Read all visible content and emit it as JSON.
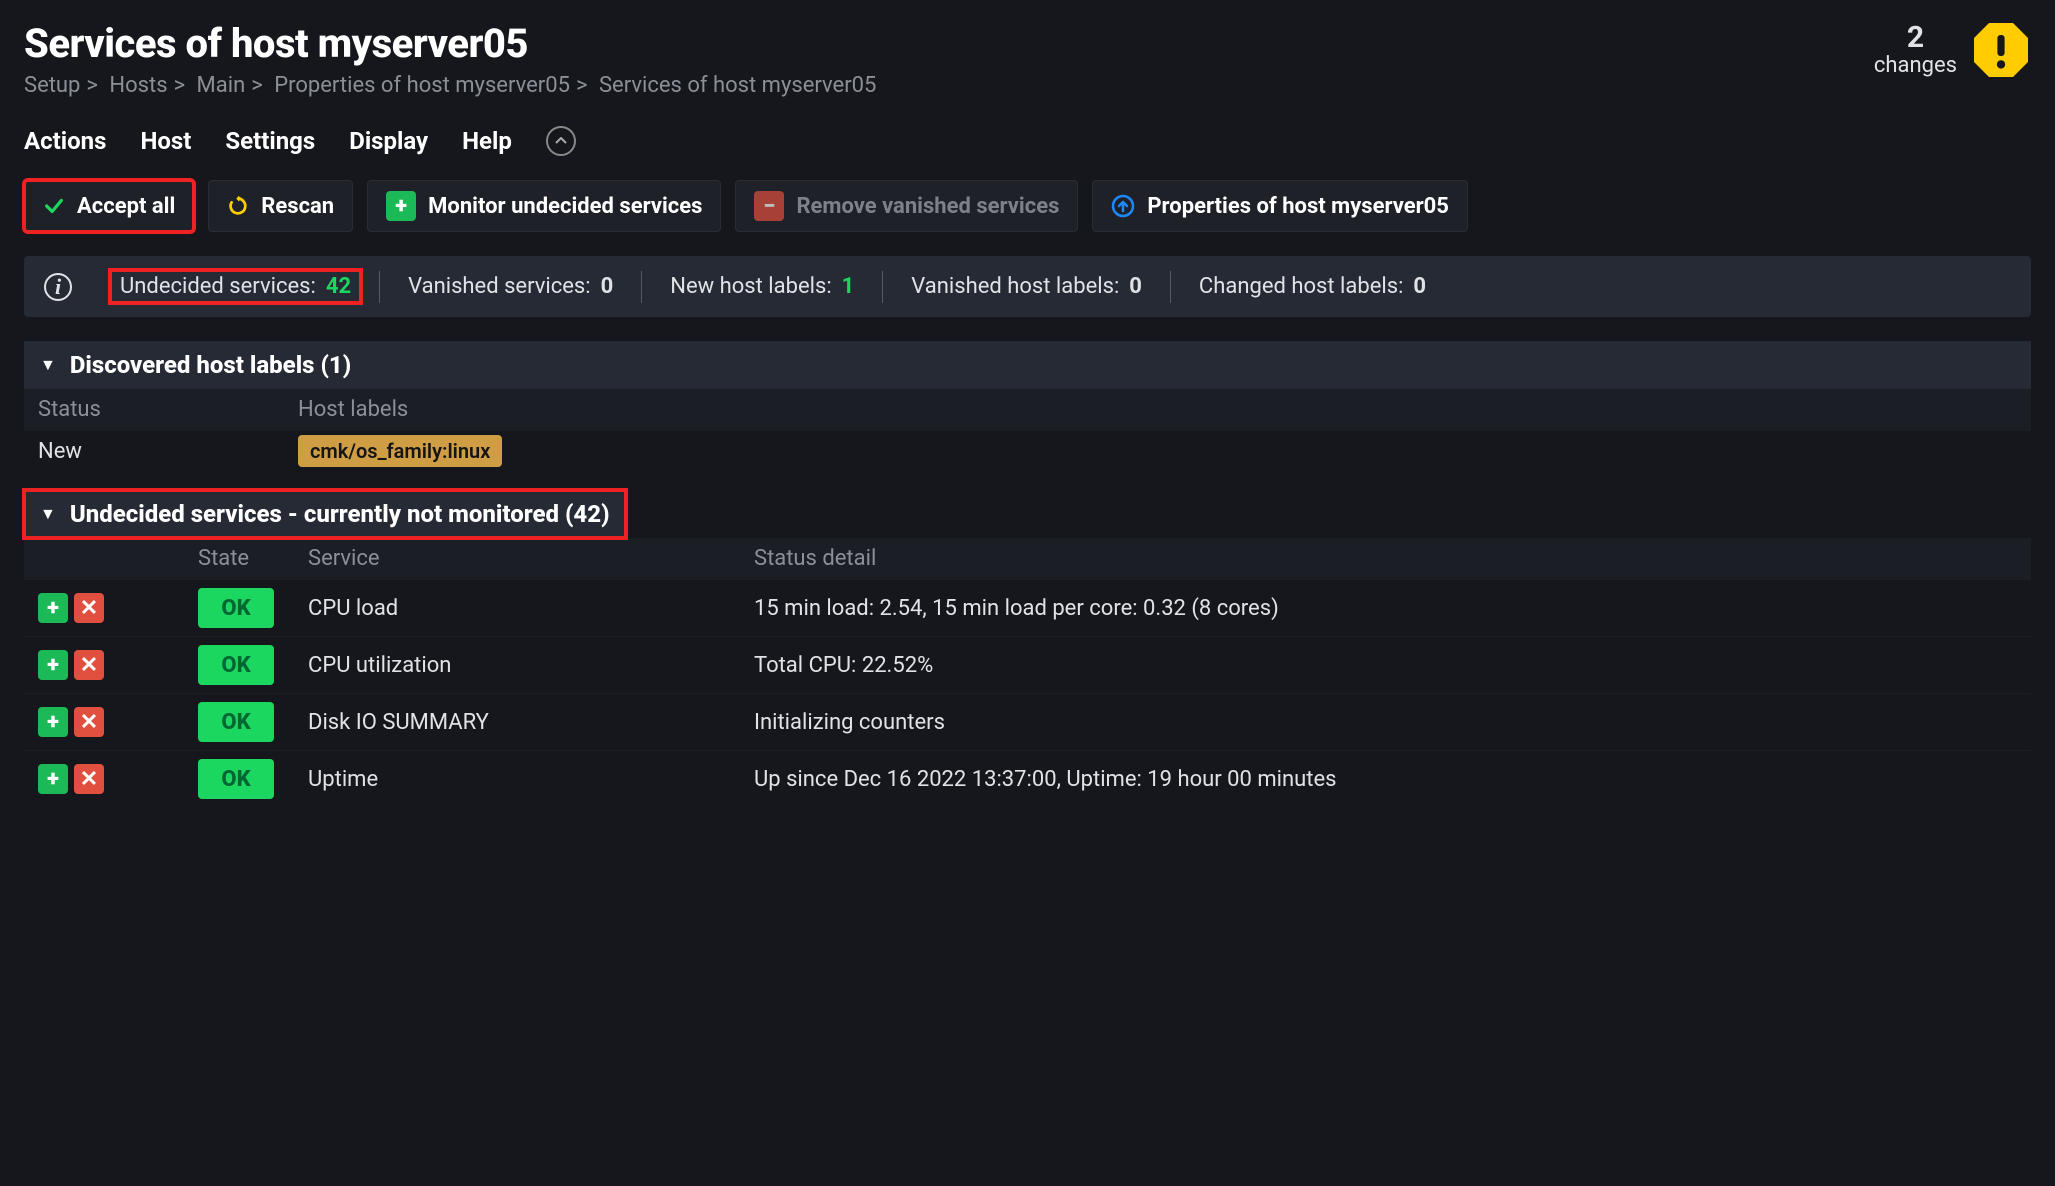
{
  "page_title": "Services of host myserver05",
  "breadcrumb": [
    "Setup",
    "Hosts",
    "Main",
    "Properties of host myserver05",
    "Services of host myserver05"
  ],
  "changes": {
    "count": "2",
    "label": "changes"
  },
  "menubar": [
    "Actions",
    "Host",
    "Settings",
    "Display",
    "Help"
  ],
  "toolbar": {
    "accept_all": "Accept all",
    "rescan": "Rescan",
    "monitor_undecided": "Monitor undecided services",
    "remove_vanished": "Remove vanished services",
    "properties": "Properties of host myserver05"
  },
  "stats": {
    "undecided_services": {
      "label": "Undecided services:",
      "value": "42"
    },
    "vanished_services": {
      "label": "Vanished services:",
      "value": "0"
    },
    "new_host_labels": {
      "label": "New host labels:",
      "value": "1"
    },
    "vanished_host_labels": {
      "label": "Vanished host labels:",
      "value": "0"
    },
    "changed_host_labels": {
      "label": "Changed host labels:",
      "value": "0"
    }
  },
  "discovered_labels": {
    "header": "Discovered host labels (1)",
    "columns": {
      "status": "Status",
      "labels": "Host labels"
    },
    "rows": [
      {
        "status": "New",
        "label": "cmk/os_family:linux"
      }
    ]
  },
  "undecided_services": {
    "header": "Undecided services - currently not monitored (42)",
    "columns": {
      "state": "State",
      "service": "Service",
      "detail": "Status detail"
    },
    "rows": [
      {
        "state": "OK",
        "service": "CPU load",
        "detail": "15 min load: 2.54, 15 min load per core: 0.32 (8 cores)"
      },
      {
        "state": "OK",
        "service": "CPU utilization",
        "detail": "Total CPU: 22.52%"
      },
      {
        "state": "OK",
        "service": "Disk IO SUMMARY",
        "detail": "Initializing counters"
      },
      {
        "state": "OK",
        "service": "Uptime",
        "detail": "Up since Dec 16 2022 13:37:00, Uptime: 19 hour 00 minutes"
      }
    ]
  },
  "colors": {
    "green": "#1bd760",
    "red": "#e14f3f",
    "orange": "#cf9d43",
    "yellow": "#ffcc00",
    "blue": "#1e88ff"
  }
}
